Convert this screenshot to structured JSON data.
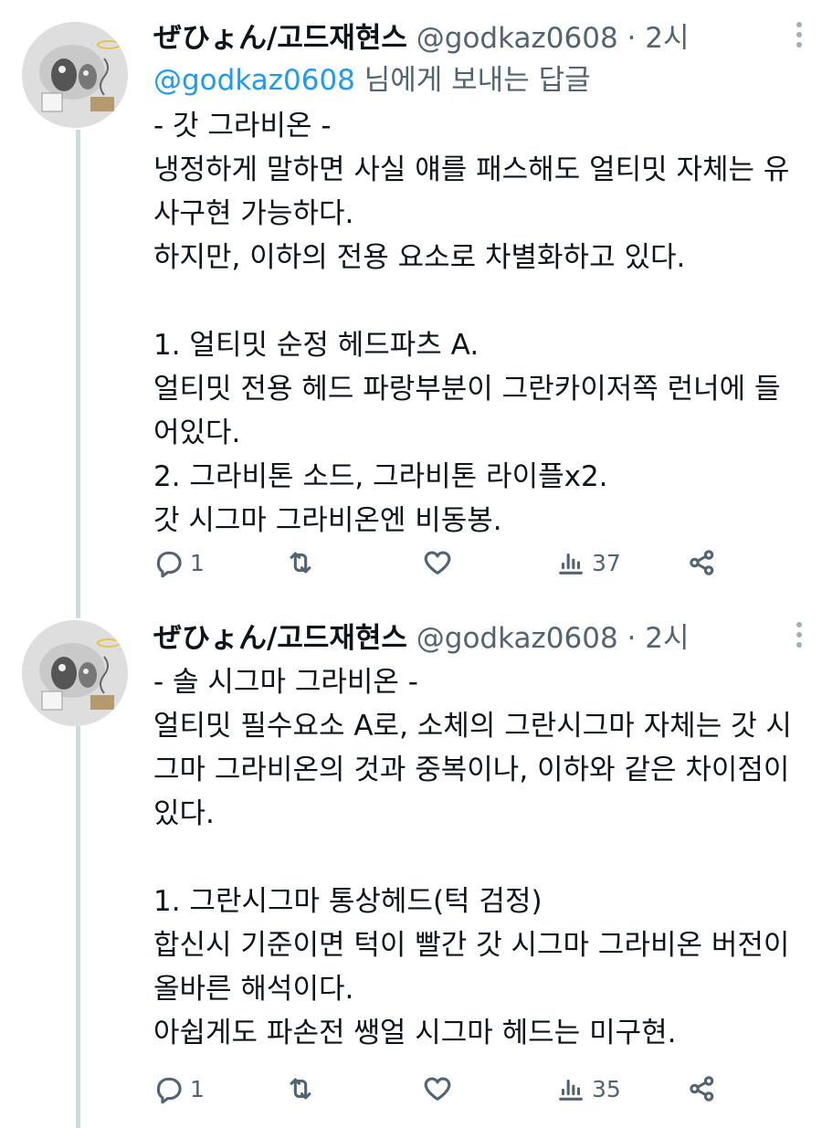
{
  "tweets": [
    {
      "author": {
        "name": "ぜひょん/고드재현스",
        "handle": "@godkaz0608",
        "time": "2시"
      },
      "reply_to": {
        "mention": "@godkaz0608",
        "suffix": " 님에게 보내는 답글"
      },
      "text": "- 갓 그라비온 -\n냉정하게 말하면 사실 얘를 패스해도 얼티밋 자체는 유사구현 가능하다.\n하지만, 이하의 전용 요소로 차별화하고 있다.\n\n1. 얼티밋 순정 헤드파츠 A.\n얼티밋 전용 헤드 파랑부분이 그란카이저쪽 런너에 들어있다.\n2. 그라비톤 소드, 그라비톤 라이플x2.\n갓 시그마 그라비온엔 비동봉.",
      "actions": {
        "replies": "1",
        "views": "37"
      }
    },
    {
      "author": {
        "name": "ぜひょん/고드재현스",
        "handle": "@godkaz0608",
        "time": "2시"
      },
      "text": "- 솔 시그마 그라비온 -\n얼티밋 필수요소 A로, 소체의 그란시그마 자체는 갓 시그마 그라비온의 것과 중복이나, 이하와 같은 차이점이 있다.\n\n1. 그란시그마 통상헤드(턱 검정)\n합신시 기준이면 턱이 빨간 갓 시그마 그라비온 버전이 올바른 해석이다.\n아쉽게도 파손전 쌩얼 시그마 헤드는 미구현.",
      "actions": {
        "replies": "1",
        "views": "35"
      }
    }
  ],
  "separator": "·",
  "icons": [
    "more-icon",
    "reply-icon",
    "retweet-icon",
    "like-icon",
    "views-icon",
    "share-icon"
  ],
  "colors": {
    "text": "#0f1419",
    "secondary": "#536471",
    "link": "#1d9bf0",
    "thread_line": "#cfd9de"
  }
}
